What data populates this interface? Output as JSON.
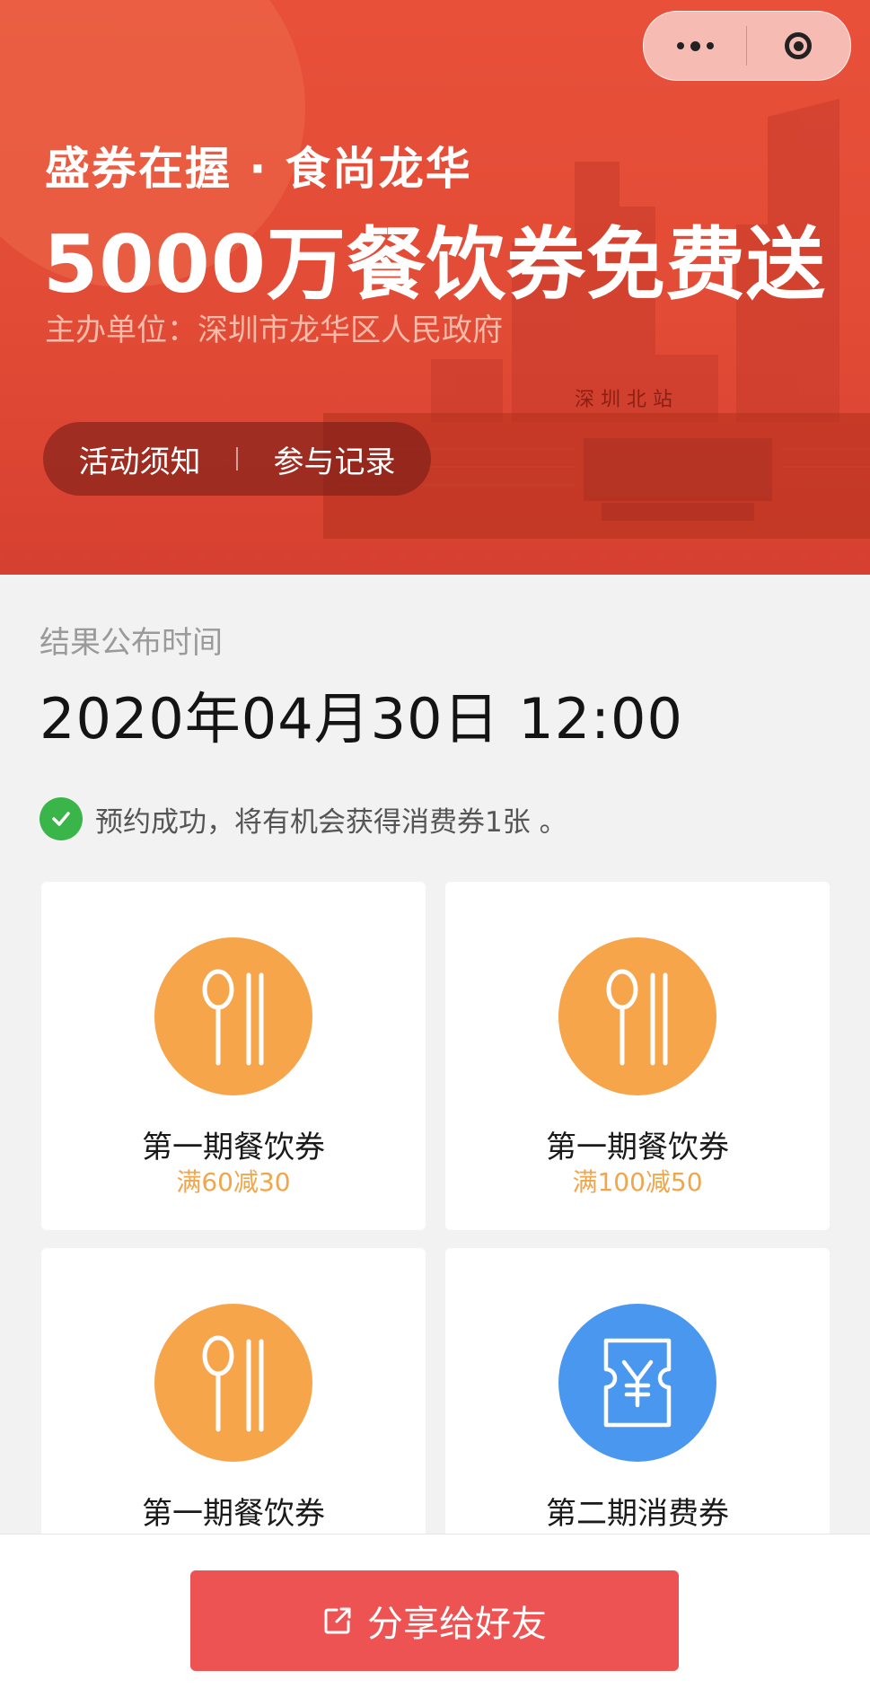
{
  "capsule": {
    "more_icon": "more-dots-icon",
    "close_icon": "circle-target-icon"
  },
  "banner": {
    "line1": "盛券在握 · 食尚龙华",
    "line2": "5000万餐饮券免费送",
    "organizer": "主办单位：深圳市龙华区人民政府",
    "station_sign": "深  圳  北  站",
    "tabs": {
      "notice": "活动须知",
      "records": "参与记录"
    }
  },
  "result": {
    "label": "结果公布时间",
    "time": "2020年04月30日 12:00"
  },
  "status": {
    "icon": "check-circle-icon",
    "text": "预约成功，将有机会获得消费券1张 。"
  },
  "coupons": [
    {
      "name": "第一期餐饮券",
      "desc": "满60减30",
      "icon": "spoon-chopsticks-icon",
      "color": "#f7a54a"
    },
    {
      "name": "第一期餐饮券",
      "desc": "满100减50",
      "icon": "spoon-chopsticks-icon",
      "color": "#f7a54a"
    },
    {
      "name": "第一期餐饮券",
      "desc": "",
      "icon": "spoon-chopsticks-icon",
      "color": "#f7a54a"
    },
    {
      "name": "第二期消费券",
      "desc": "",
      "icon": "yen-ticket-icon",
      "color": "#4a97f0"
    }
  ],
  "share": {
    "label": "分享给好友",
    "icon": "share-out-icon"
  },
  "colors": {
    "banner": "#e24b35",
    "accent_orange": "#f7a54a",
    "button_red": "#ec5352",
    "success_green": "#39b54a"
  }
}
